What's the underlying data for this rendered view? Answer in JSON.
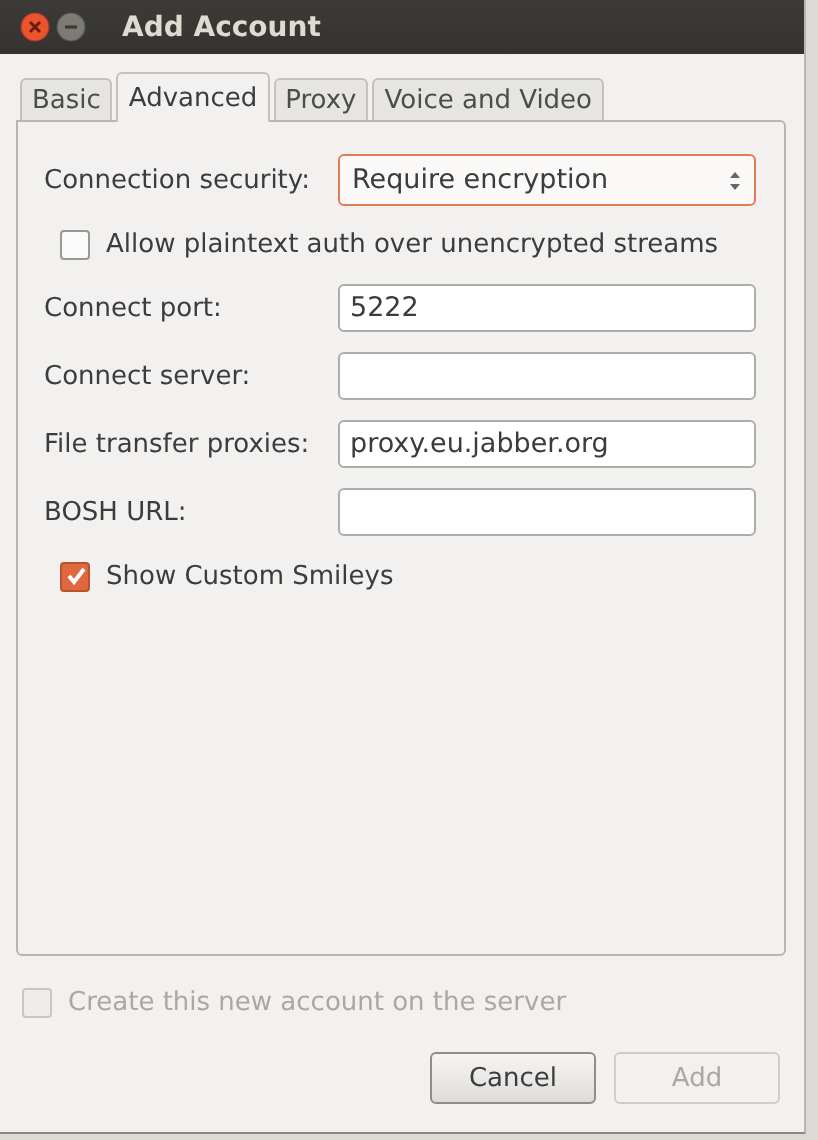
{
  "window": {
    "title": "Add Account"
  },
  "tabs": [
    {
      "label": "Basic",
      "selected": false
    },
    {
      "label": "Advanced",
      "selected": true
    },
    {
      "label": "Proxy",
      "selected": false
    },
    {
      "label": "Voice and Video",
      "selected": false
    }
  ],
  "settings": [
    {
      "kind": "select",
      "label": "Connection security:",
      "value": "Require encryption"
    },
    {
      "kind": "checkbox",
      "label": "Allow plaintext auth over unencrypted streams",
      "checked": false
    },
    {
      "kind": "text",
      "label": "Connect port:",
      "value": "5222"
    },
    {
      "kind": "text",
      "label": "Connect server:"
    },
    {
      "kind": "text",
      "label": "File transfer proxies:",
      "value": "proxy.eu.jabber.org"
    },
    {
      "kind": "text",
      "label": "BOSH URL:"
    },
    {
      "kind": "checkbox",
      "label": "Show Custom Smileys",
      "checked": true
    }
  ],
  "create_account": {
    "label": "Create this new account on the server",
    "checked": false,
    "disabled": true
  },
  "buttons": [
    {
      "label": "Cancel",
      "disabled": false
    },
    {
      "label": "Add",
      "disabled": true
    }
  ]
}
